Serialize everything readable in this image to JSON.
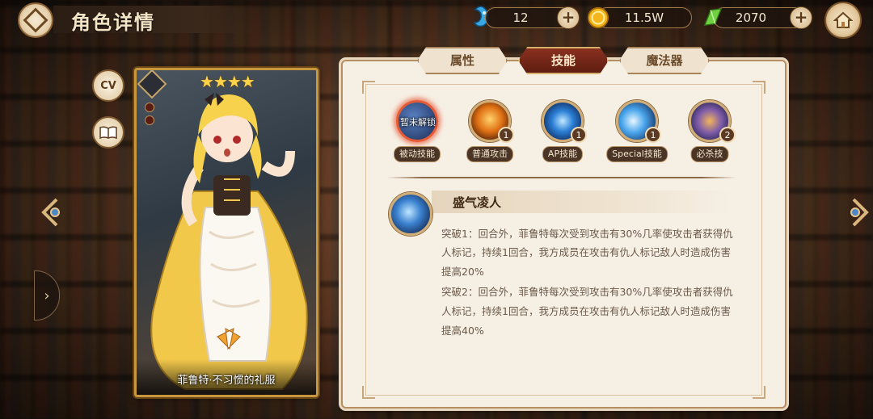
{
  "header": {
    "title": "角色详情"
  },
  "resources": [
    {
      "name": "blue-fish-currency",
      "value": "12",
      "color": "#3aa6e0"
    },
    {
      "name": "gold-coin",
      "value": "11.5W",
      "color": "#f3b71f"
    },
    {
      "name": "green-leaf-crystal",
      "value": "2070",
      "color": "#5cc23d"
    }
  ],
  "side_buttons": {
    "cv_label": "CV"
  },
  "character": {
    "stars": "★★★★",
    "name": "菲鲁特·不习惯的礼服"
  },
  "tabs": [
    {
      "label": "属性",
      "active": false
    },
    {
      "label": "技能",
      "active": true
    },
    {
      "label": "魔法器",
      "active": false
    }
  ],
  "skills": [
    {
      "label": "被动技能",
      "badge": "",
      "status": "暂未解锁",
      "selected": true
    },
    {
      "label": "普通攻击",
      "badge": "1",
      "selected": false
    },
    {
      "label": "AP技能",
      "badge": "1",
      "selected": false
    },
    {
      "label": "Special技能",
      "badge": "1",
      "selected": false
    },
    {
      "label": "必杀技",
      "badge": "2",
      "selected": false
    }
  ],
  "detail": {
    "skill_name": "盛气凌人",
    "lines": [
      "突破1：回合外，菲鲁特每次受到攻击有30%几率使攻击者获得仇",
      "人标记，持续1回合，我方成员在攻击有仇人标记敌人时造成伤害",
      "提高20%",
      "突破2：回合外，菲鲁特每次受到攻击有30%几率使攻击者获得仇",
      "人标记，持续1回合，我方成员在攻击有仇人标记敌人时造成伤害",
      "提高40%"
    ]
  }
}
